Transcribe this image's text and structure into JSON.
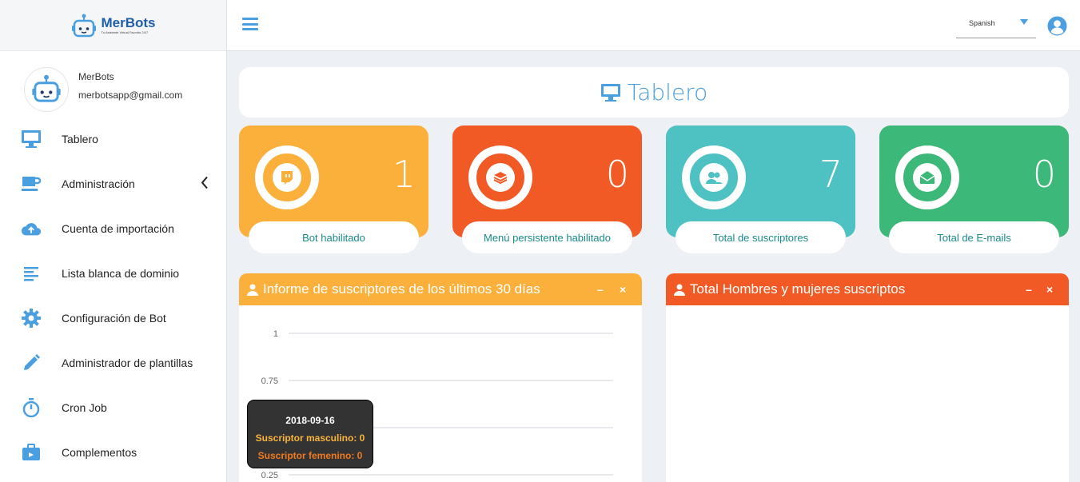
{
  "brand": {
    "name": "MerBots",
    "tagline": "Tu Asistente Virtual Favorito 24/7"
  },
  "profile": {
    "name": "MerBots",
    "email": "merbotsapp@gmail.com"
  },
  "menu": [
    {
      "label": "Tablero",
      "icon": "monitor-icon"
    },
    {
      "label": "Administración",
      "icon": "coffee-cup-icon"
    },
    {
      "label": "Cuenta de importación",
      "icon": "cloud-upload-icon"
    },
    {
      "label": "Lista blanca de dominio",
      "icon": "align-left-icon"
    },
    {
      "label": "Configuración de Bot",
      "icon": "gear-icon"
    },
    {
      "label": "Administrador de plantillas",
      "icon": "pencil-icon"
    },
    {
      "label": "Cron Job",
      "icon": "stopwatch-icon"
    },
    {
      "label": "Complementos",
      "icon": "briefcase-icon"
    }
  ],
  "topbar": {
    "language": "Spanish"
  },
  "page_title": "Tablero",
  "stats": [
    {
      "value": "1",
      "label": "Bot habilitado",
      "color": "#fbb03b",
      "icon": "twitch-icon"
    },
    {
      "value": "0",
      "label": "Menú persistente habilitado",
      "color": "#f15a24",
      "icon": "layers-icon"
    },
    {
      "value": "7",
      "label": "Total de suscriptores",
      "color": "#4ec2c2",
      "icon": "users-icon"
    },
    {
      "value": "0",
      "label": "Total de E-mails",
      "color": "#3cb878",
      "icon": "envelope-open-icon"
    }
  ],
  "panels": {
    "subscribers_report": {
      "title": "Informe de suscriptores de los últimos 30 días",
      "color": "#fbb03b",
      "minimize": "–",
      "close": "×"
    },
    "gender": {
      "title": "Total Hombres y mujeres suscriptos",
      "color": "#f15a24",
      "minimize": "–",
      "close": "×"
    }
  },
  "chart_data": {
    "type": "line",
    "x": [
      "2018-09-16"
    ],
    "series": [
      {
        "name": "Suscriptor masculino",
        "values": [
          0
        ],
        "color": "#f9b43c"
      },
      {
        "name": "Suscriptor femenino",
        "values": [
          0
        ],
        "color": "#f07b1f"
      }
    ],
    "yticks": [
      "1",
      "0.75",
      "0.5",
      "0.25"
    ],
    "ylim": [
      0,
      1
    ],
    "grid": true
  },
  "tooltip": {
    "date": "2018-09-16",
    "male": "Suscriptor masculino: 0",
    "female": "Suscriptor femenino: 0"
  }
}
